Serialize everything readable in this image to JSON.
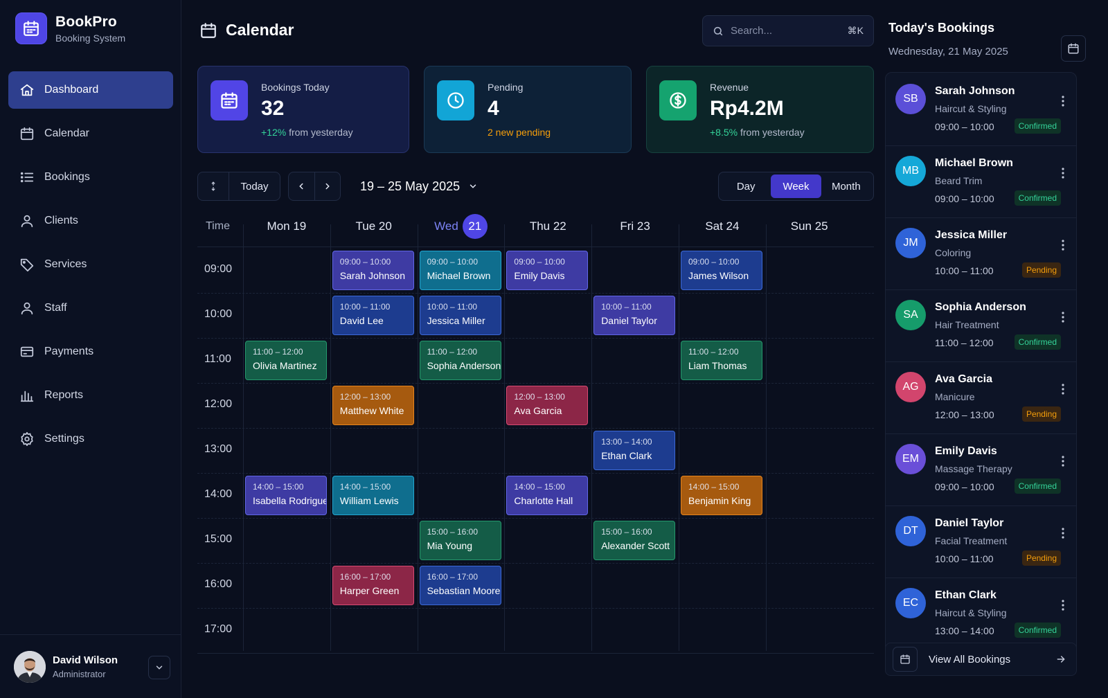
{
  "brand": {
    "name": "BookPro",
    "subtitle": "Booking System",
    "logo_icon": "calendar-icon",
    "color": "#4f46e5"
  },
  "sidebar": {
    "items": [
      {
        "label": "Dashboard",
        "icon": "home-icon",
        "active": true
      },
      {
        "label": "Calendar",
        "icon": "calendar-icon"
      },
      {
        "label": "Bookings",
        "icon": "list-icon"
      },
      {
        "label": "Clients",
        "icon": "user-icon"
      },
      {
        "label": "Services",
        "icon": "tag-icon"
      },
      {
        "label": "Staff",
        "icon": "user-icon"
      },
      {
        "label": "Payments",
        "icon": "credit-card-icon"
      },
      {
        "label": "Reports",
        "icon": "bar-chart-icon"
      },
      {
        "label": "Settings",
        "icon": "gear-icon"
      }
    ],
    "user": {
      "name": "David Wilson",
      "role": "Administrator"
    }
  },
  "header": {
    "title": "Calendar",
    "search": {
      "placeholder": "Search...",
      "shortcut": "⌘K"
    }
  },
  "stats": [
    {
      "label": "Bookings Today",
      "value": "32",
      "note_highlight": "+12%",
      "note_rest": " from yesterday",
      "color": "#5145e6",
      "icon": "calendar-icon"
    },
    {
      "label": "Pending",
      "value": "4",
      "note_highlight": "2 new pending",
      "note_rest": "",
      "color": "#12a5d6",
      "icon": "clock-icon"
    },
    {
      "label": "Revenue",
      "value": "Rp4.2M",
      "note_highlight": "+8.5%",
      "note_rest": " from yesterday",
      "color": "#15a36f",
      "icon": "dollar-icon"
    }
  ],
  "toolbar": {
    "today_label": "Today",
    "range_label": "19 – 25 May 2025",
    "views": [
      "Day",
      "Week",
      "Month"
    ],
    "active_view": "Week"
  },
  "calendar": {
    "time_header": "Time",
    "days": [
      {
        "label": "Mon 19"
      },
      {
        "label": "Tue 20"
      },
      {
        "label": "Wed",
        "badge": "21",
        "today": true
      },
      {
        "label": "Thu 22"
      },
      {
        "label": "Fri 23"
      },
      {
        "label": "Sat 24"
      },
      {
        "label": "Sun 25"
      }
    ],
    "hours": [
      "09:00",
      "10:00",
      "11:00",
      "12:00",
      "13:00",
      "14:00",
      "15:00",
      "16:00",
      "17:00"
    ],
    "events": [
      {
        "day": 1,
        "hour": 0,
        "time": "09:00 – 10:00",
        "name": "Sarah Johnson",
        "color": "indigo"
      },
      {
        "day": 2,
        "hour": 0,
        "time": "09:00 – 10:00",
        "name": "Michael Brown",
        "color": "cyan"
      },
      {
        "day": 3,
        "hour": 0,
        "time": "09:00 – 10:00",
        "name": "Emily Davis",
        "color": "indigo"
      },
      {
        "day": 5,
        "hour": 0,
        "time": "09:00 – 10:00",
        "name": "James Wilson",
        "color": "blue"
      },
      {
        "day": 1,
        "hour": 1,
        "time": "10:00 – 11:00",
        "name": "David Lee",
        "color": "blue"
      },
      {
        "day": 2,
        "hour": 1,
        "time": "10:00 – 11:00",
        "name": "Jessica Miller",
        "color": "blue"
      },
      {
        "day": 4,
        "hour": 1,
        "time": "10:00 – 11:00",
        "name": "Daniel Taylor",
        "color": "indigo"
      },
      {
        "day": 0,
        "hour": 2,
        "time": "11:00 – 12:00",
        "name": "Olivia Martinez",
        "color": "green"
      },
      {
        "day": 2,
        "hour": 2,
        "time": "11:00 – 12:00",
        "name": "Sophia Anderson",
        "color": "green"
      },
      {
        "day": 5,
        "hour": 2,
        "time": "11:00 – 12:00",
        "name": "Liam Thomas",
        "color": "green"
      },
      {
        "day": 1,
        "hour": 3,
        "time": "12:00 – 13:00",
        "name": "Matthew White",
        "color": "orange"
      },
      {
        "day": 3,
        "hour": 3,
        "time": "12:00 – 13:00",
        "name": "Ava Garcia",
        "color": "rose"
      },
      {
        "day": 4,
        "hour": 4,
        "time": "13:00 – 14:00",
        "name": "Ethan Clark",
        "color": "blue"
      },
      {
        "day": 0,
        "hour": 5,
        "time": "14:00 – 15:00",
        "name": "Isabella Rodriguez",
        "color": "indigo"
      },
      {
        "day": 1,
        "hour": 5,
        "time": "14:00 – 15:00",
        "name": "William Lewis",
        "color": "cyan"
      },
      {
        "day": 3,
        "hour": 5,
        "time": "14:00 – 15:00",
        "name": "Charlotte Hall",
        "color": "indigo"
      },
      {
        "day": 5,
        "hour": 5,
        "time": "14:00 – 15:00",
        "name": "Benjamin King",
        "color": "orange"
      },
      {
        "day": 2,
        "hour": 6,
        "time": "15:00 – 16:00",
        "name": "Mia Young",
        "color": "green"
      },
      {
        "day": 4,
        "hour": 6,
        "time": "15:00 – 16:00",
        "name": "Alexander Scott",
        "color": "green"
      },
      {
        "day": 1,
        "hour": 7,
        "time": "16:00 – 17:00",
        "name": "Harper Green",
        "color": "rose"
      },
      {
        "day": 2,
        "hour": 7,
        "time": "16:00 – 17:00",
        "name": "Sebastian Moore",
        "color": "blue"
      }
    ]
  },
  "today_panel": {
    "title": "Today's Bookings",
    "date": "Wednesday, 21 May 2025",
    "bookings": [
      {
        "initials": "SB",
        "name": "Sarah Johnson",
        "service": "Haircut & Styling",
        "time": "09:00 – 10:00",
        "status": "Confirmed",
        "avatar_color": "#5b4fd8"
      },
      {
        "initials": "MB",
        "name": "Michael Brown",
        "service": "Beard Trim",
        "time": "09:00 – 10:00",
        "status": "Confirmed",
        "avatar_color": "#15a8d8"
      },
      {
        "initials": "JM",
        "name": "Jessica Miller",
        "service": "Coloring",
        "time": "10:00 – 11:00",
        "status": "Pending",
        "avatar_color": "#2f63d8"
      },
      {
        "initials": "SA",
        "name": "Sophia Anderson",
        "service": "Hair Treatment",
        "time": "11:00 – 12:00",
        "status": "Confirmed",
        "avatar_color": "#169c6b"
      },
      {
        "initials": "AG",
        "name": "Ava Garcia",
        "service": "Manicure",
        "time": "12:00 – 13:00",
        "status": "Pending",
        "avatar_color": "#d2456d"
      },
      {
        "initials": "EM",
        "name": "Emily Davis",
        "service": "Massage Therapy",
        "time": "09:00 – 10:00",
        "status": "Confirmed",
        "avatar_color": "#6a4fd8"
      },
      {
        "initials": "DT",
        "name": "Daniel Taylor",
        "service": "Facial Treatment",
        "time": "10:00 – 11:00",
        "status": "Pending",
        "avatar_color": "#2f63d8"
      },
      {
        "initials": "EC",
        "name": "Ethan Clark",
        "service": "Haircut & Styling",
        "time": "13:00 – 14:00",
        "status": "Confirmed",
        "avatar_color": "#2f63d8"
      }
    ],
    "view_all_label": "View All Bookings"
  }
}
